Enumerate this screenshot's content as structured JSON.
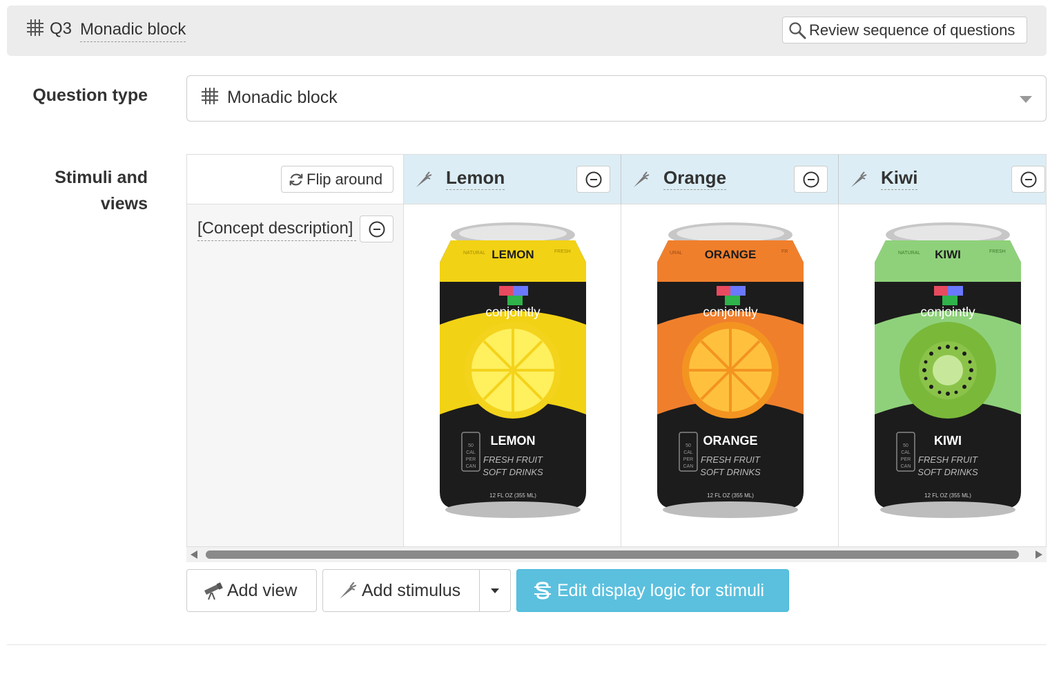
{
  "header": {
    "question_number": "Q3",
    "question_title": "Monadic block",
    "review_button_label": "Review sequence of questions",
    "icons": {
      "type": "grid-icon",
      "review": "search-icon"
    }
  },
  "form": {
    "question_type_label": "Question type",
    "question_type_value": "Monadic block",
    "stimuli_label_line1": "Stimuli and",
    "stimuli_label_line2": "views"
  },
  "grid": {
    "flip_label": "Flip around",
    "rows": [
      {
        "label": "[Concept description]"
      }
    ],
    "stimuli": [
      {
        "name": "Lemon",
        "can": {
          "top_band": "LEMON",
          "brand": "conjointly",
          "big_name": "LEMON",
          "line1": "FRESH FRUIT",
          "line2": "SOFT DRINKS",
          "volume": "12 FL OZ (355 ML)",
          "side_left": "NATURAL",
          "side_right": "FRESH",
          "cal": [
            "50",
            "CAL",
            "PER",
            "CAN"
          ]
        },
        "colors": {
          "primary": "#f2d215",
          "secondary": "#ffe455",
          "fruit_outer": "#f4d31c",
          "fruit_inner": "#fff05e"
        }
      },
      {
        "name": "Orange",
        "can": {
          "top_band": "ORANGE",
          "brand": "conjointly",
          "big_name": "ORANGE",
          "line1": "FRESH FRUIT",
          "line2": "SOFT DRINKS",
          "volume": "12 FL OZ (355 ML)",
          "side_left": "URAL",
          "side_right": "FR",
          "cal": [
            "50",
            "CAL",
            "PER",
            "CAN"
          ]
        },
        "colors": {
          "primary": "#f07f2c",
          "secondary": "#ff9a44",
          "fruit_outer": "#f39421",
          "fruit_inner": "#ffc13d"
        }
      },
      {
        "name": "Kiwi",
        "can": {
          "top_band": "KIWI",
          "brand": "conjointly",
          "big_name": "KIWI",
          "line1": "FRESH FRUIT",
          "line2": "SOFT DRINKS",
          "volume": "12 FL OZ (355 ML)",
          "side_left": "NATURAL",
          "side_right": "FRESH",
          "cal": [
            "50",
            "CAL",
            "PER",
            "CAN"
          ]
        },
        "colors": {
          "primary": "#8fd17b",
          "secondary": "#aee49a",
          "fruit_outer": "#7ab83a",
          "fruit_inner": "#c7e89a"
        }
      }
    ]
  },
  "actions": {
    "add_view": "Add view",
    "add_stimulus": "Add stimulus",
    "edit_display_logic": "Edit display logic for stimuli"
  },
  "colors": {
    "header_bg": "#ececec",
    "stimulus_header_bg": "#dcedf5",
    "info_button": "#5bc0de"
  }
}
